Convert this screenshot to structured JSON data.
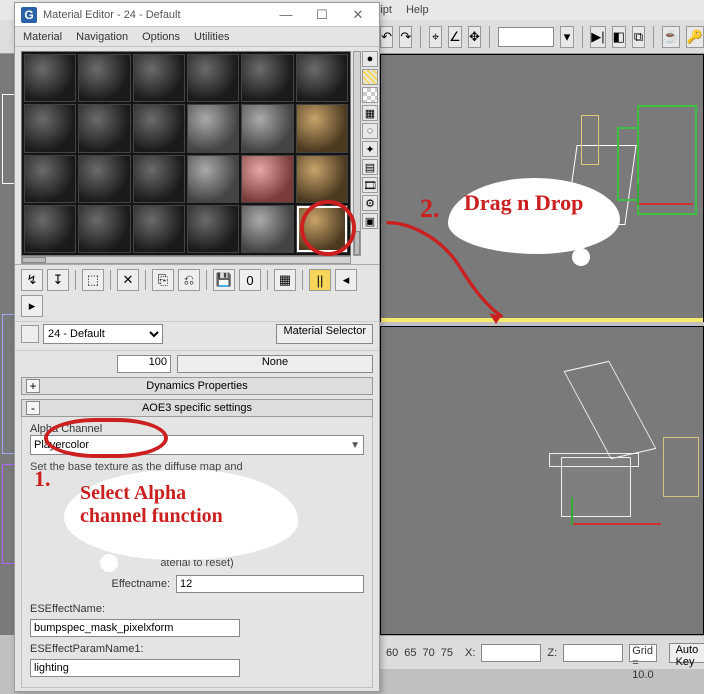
{
  "app_menu": {
    "items": [
      "MAXScript",
      "Help"
    ]
  },
  "app_toolbar": {
    "icons": [
      "undo",
      "redo",
      "link",
      "sep",
      "snap",
      "snap2",
      "axis",
      "sep",
      "combo",
      "sep",
      "rubix",
      "play",
      "sep",
      "sel1",
      "sel2",
      "sel3",
      "sep",
      "teapot",
      "key"
    ]
  },
  "statusbar": {
    "labels": {
      "x": "X:",
      "z": "Z:",
      "grid": "Grid = 10.0",
      "auto_key": "Auto Key"
    },
    "values": {
      "xfield": "",
      "zfield": "",
      "other": ""
    },
    "tick_icons": [
      "60",
      "65",
      "70",
      "75"
    ]
  },
  "material_editor": {
    "title": "Material Editor - 24 - Default",
    "window_buttons": {
      "min": "—",
      "max": "☐",
      "close": "✕"
    },
    "menu": [
      "Material",
      "Navigation",
      "Options",
      "Utilities"
    ],
    "side_icons": [
      "sphere",
      "striped",
      "check",
      "colwheel",
      "snap",
      "light",
      "ortho",
      "film",
      "opt",
      "select"
    ],
    "toolrow": [
      "pick",
      "apply",
      "reset",
      "sep",
      "del",
      "sep",
      "link1",
      "link2",
      "sep",
      "save",
      "num",
      "sep",
      "showmap",
      "sep",
      "col1",
      "col2",
      "col3",
      "sep",
      "graph"
    ],
    "picker": {
      "combo": "24 - Default",
      "button": "Material Selector",
      "eyedrop": "eyedropper"
    },
    "opacity_row": {
      "value": "100",
      "map": "None"
    },
    "rollouts": {
      "dyn": {
        "pm": "+",
        "title": "Dynamics Properties"
      },
      "aoe": {
        "pm": "-",
        "title": "AOE3 specific settings",
        "alpha_label": "Alpha Channel",
        "alpha_value": "Playercolor",
        "desc1": "Set the base texture as the diffuse map and",
        "reset_note": "aterial to reset)",
        "effect_label": "Effectname:",
        "effect_value": "12",
        "es_name_label": "ESEffectName:",
        "es_name_value": "bumpspec_mask_pixelxform",
        "es_param_label": "ESEffectParamName1:",
        "es_param_value": "lighting"
      }
    }
  },
  "annotations": {
    "num1": "1.",
    "num2": "2.",
    "select_text": "Select Alpha\nchannel function",
    "drag_text": "Drag n Drop"
  }
}
